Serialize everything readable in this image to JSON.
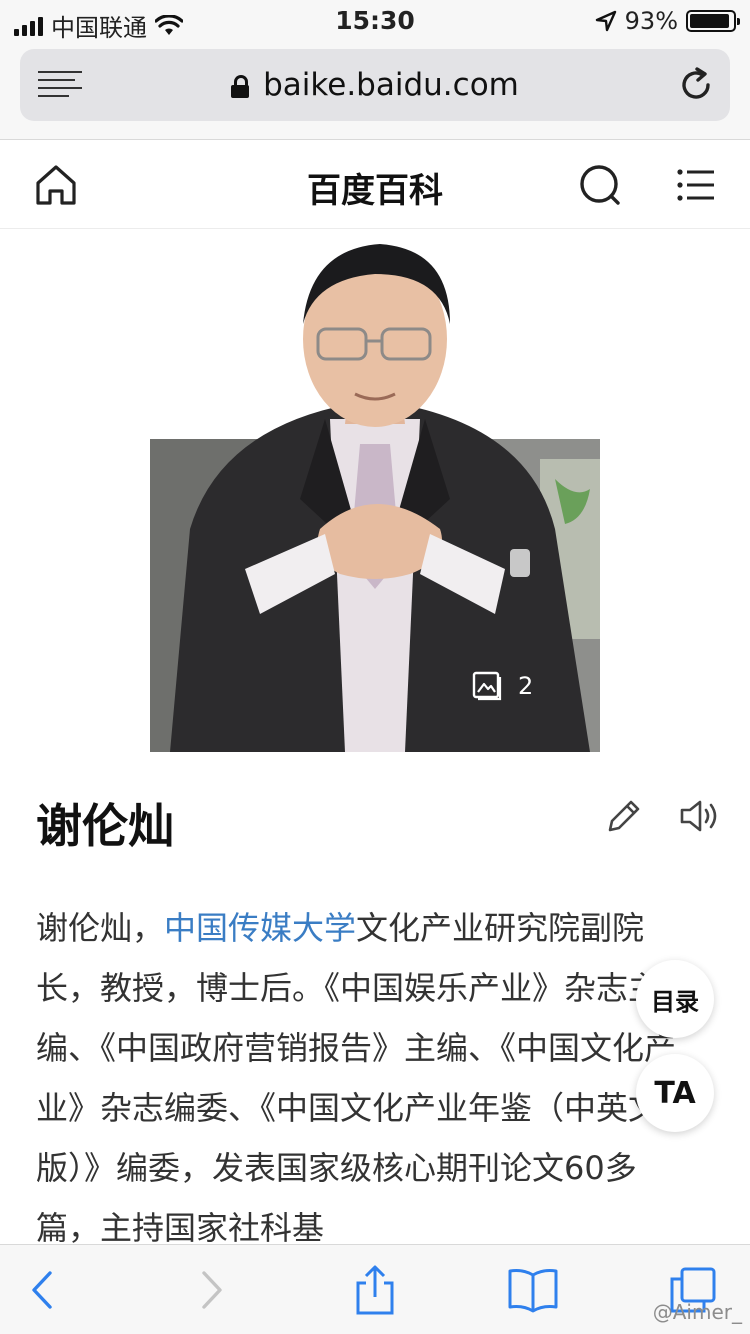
{
  "status_bar": {
    "carrier": "中国联通",
    "time": "15:30",
    "battery": "93%",
    "battery_level": 0.93
  },
  "browser": {
    "url": "baike.baidu.com"
  },
  "site": {
    "title": "百度百科"
  },
  "photo": {
    "count": "2"
  },
  "entry": {
    "title": "谢伦灿",
    "summary_prefix": "谢伦灿，",
    "summary_link": "中国传媒大学",
    "summary_rest": "文化产业研究院副院长，教授，博士后。《中国娱乐产业》杂志主编、《中国政府营销报告》主编、《中国文化产业》杂志编委、《中国文化产业年鉴（中英文版）》编委，发表国家级核心期刊论文60多篇，主持国家社科基"
  },
  "floating": {
    "toc": "目录",
    "ta": "TA"
  },
  "watermark": "@Aimer_",
  "colors": {
    "link": "#3a7dc4",
    "accent_blue": "#2f80ed"
  }
}
